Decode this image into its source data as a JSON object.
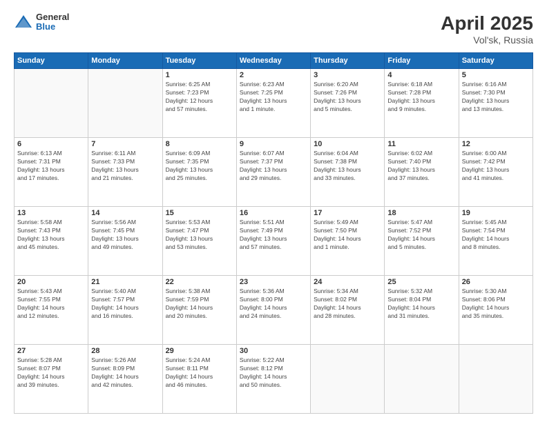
{
  "header": {
    "logo_general": "General",
    "logo_blue": "Blue",
    "title": "April 2025",
    "location": "Vol'sk, Russia"
  },
  "calendar": {
    "days_of_week": [
      "Sunday",
      "Monday",
      "Tuesday",
      "Wednesday",
      "Thursday",
      "Friday",
      "Saturday"
    ],
    "weeks": [
      [
        {
          "day": "",
          "info": ""
        },
        {
          "day": "",
          "info": ""
        },
        {
          "day": "1",
          "info": "Sunrise: 6:25 AM\nSunset: 7:23 PM\nDaylight: 12 hours\nand 57 minutes."
        },
        {
          "day": "2",
          "info": "Sunrise: 6:23 AM\nSunset: 7:25 PM\nDaylight: 13 hours\nand 1 minute."
        },
        {
          "day": "3",
          "info": "Sunrise: 6:20 AM\nSunset: 7:26 PM\nDaylight: 13 hours\nand 5 minutes."
        },
        {
          "day": "4",
          "info": "Sunrise: 6:18 AM\nSunset: 7:28 PM\nDaylight: 13 hours\nand 9 minutes."
        },
        {
          "day": "5",
          "info": "Sunrise: 6:16 AM\nSunset: 7:30 PM\nDaylight: 13 hours\nand 13 minutes."
        }
      ],
      [
        {
          "day": "6",
          "info": "Sunrise: 6:13 AM\nSunset: 7:31 PM\nDaylight: 13 hours\nand 17 minutes."
        },
        {
          "day": "7",
          "info": "Sunrise: 6:11 AM\nSunset: 7:33 PM\nDaylight: 13 hours\nand 21 minutes."
        },
        {
          "day": "8",
          "info": "Sunrise: 6:09 AM\nSunset: 7:35 PM\nDaylight: 13 hours\nand 25 minutes."
        },
        {
          "day": "9",
          "info": "Sunrise: 6:07 AM\nSunset: 7:37 PM\nDaylight: 13 hours\nand 29 minutes."
        },
        {
          "day": "10",
          "info": "Sunrise: 6:04 AM\nSunset: 7:38 PM\nDaylight: 13 hours\nand 33 minutes."
        },
        {
          "day": "11",
          "info": "Sunrise: 6:02 AM\nSunset: 7:40 PM\nDaylight: 13 hours\nand 37 minutes."
        },
        {
          "day": "12",
          "info": "Sunrise: 6:00 AM\nSunset: 7:42 PM\nDaylight: 13 hours\nand 41 minutes."
        }
      ],
      [
        {
          "day": "13",
          "info": "Sunrise: 5:58 AM\nSunset: 7:43 PM\nDaylight: 13 hours\nand 45 minutes."
        },
        {
          "day": "14",
          "info": "Sunrise: 5:56 AM\nSunset: 7:45 PM\nDaylight: 13 hours\nand 49 minutes."
        },
        {
          "day": "15",
          "info": "Sunrise: 5:53 AM\nSunset: 7:47 PM\nDaylight: 13 hours\nand 53 minutes."
        },
        {
          "day": "16",
          "info": "Sunrise: 5:51 AM\nSunset: 7:49 PM\nDaylight: 13 hours\nand 57 minutes."
        },
        {
          "day": "17",
          "info": "Sunrise: 5:49 AM\nSunset: 7:50 PM\nDaylight: 14 hours\nand 1 minute."
        },
        {
          "day": "18",
          "info": "Sunrise: 5:47 AM\nSunset: 7:52 PM\nDaylight: 14 hours\nand 5 minutes."
        },
        {
          "day": "19",
          "info": "Sunrise: 5:45 AM\nSunset: 7:54 PM\nDaylight: 14 hours\nand 8 minutes."
        }
      ],
      [
        {
          "day": "20",
          "info": "Sunrise: 5:43 AM\nSunset: 7:55 PM\nDaylight: 14 hours\nand 12 minutes."
        },
        {
          "day": "21",
          "info": "Sunrise: 5:40 AM\nSunset: 7:57 PM\nDaylight: 14 hours\nand 16 minutes."
        },
        {
          "day": "22",
          "info": "Sunrise: 5:38 AM\nSunset: 7:59 PM\nDaylight: 14 hours\nand 20 minutes."
        },
        {
          "day": "23",
          "info": "Sunrise: 5:36 AM\nSunset: 8:00 PM\nDaylight: 14 hours\nand 24 minutes."
        },
        {
          "day": "24",
          "info": "Sunrise: 5:34 AM\nSunset: 8:02 PM\nDaylight: 14 hours\nand 28 minutes."
        },
        {
          "day": "25",
          "info": "Sunrise: 5:32 AM\nSunset: 8:04 PM\nDaylight: 14 hours\nand 31 minutes."
        },
        {
          "day": "26",
          "info": "Sunrise: 5:30 AM\nSunset: 8:06 PM\nDaylight: 14 hours\nand 35 minutes."
        }
      ],
      [
        {
          "day": "27",
          "info": "Sunrise: 5:28 AM\nSunset: 8:07 PM\nDaylight: 14 hours\nand 39 minutes."
        },
        {
          "day": "28",
          "info": "Sunrise: 5:26 AM\nSunset: 8:09 PM\nDaylight: 14 hours\nand 42 minutes."
        },
        {
          "day": "29",
          "info": "Sunrise: 5:24 AM\nSunset: 8:11 PM\nDaylight: 14 hours\nand 46 minutes."
        },
        {
          "day": "30",
          "info": "Sunrise: 5:22 AM\nSunset: 8:12 PM\nDaylight: 14 hours\nand 50 minutes."
        },
        {
          "day": "",
          "info": ""
        },
        {
          "day": "",
          "info": ""
        },
        {
          "day": "",
          "info": ""
        }
      ]
    ]
  }
}
